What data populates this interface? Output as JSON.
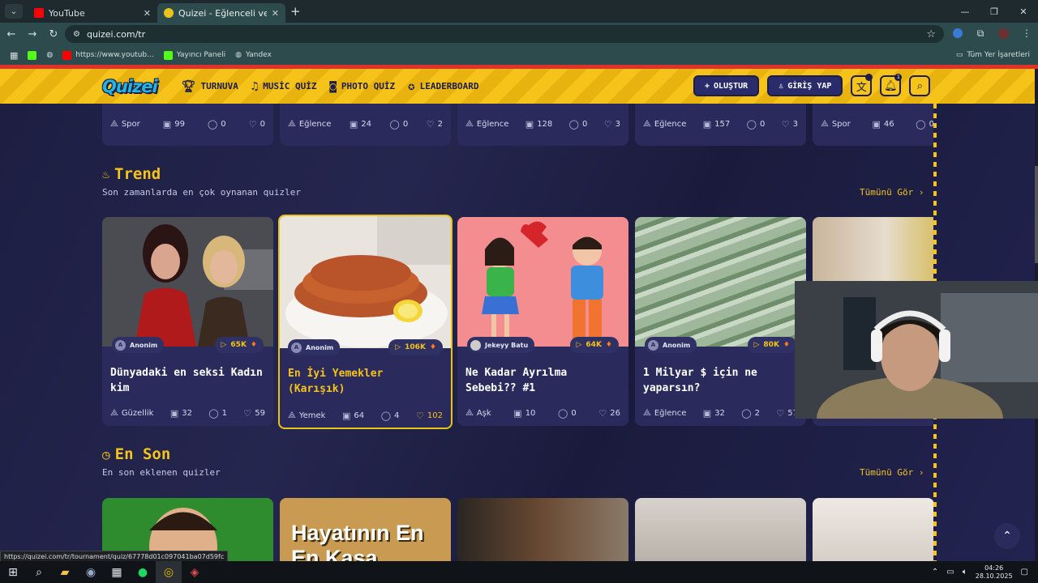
{
  "browser": {
    "tabs": [
      {
        "title": "YouTube",
        "active": false
      },
      {
        "title": "Quizei - Eğlenceli ve etkileşimli",
        "active": true
      }
    ],
    "url": "quizei.com/tr",
    "bookmarks": [
      "https://www.youtub...",
      "Yayıncı Paneli",
      "Yandex"
    ],
    "bookmarks_right": "Tüm Yer İşaretleri",
    "status_url": "https://quizei.com/tr/tournament/quiz/67778d01c097041ba07d59fc"
  },
  "header": {
    "logo": "Quizei",
    "nav": [
      "TURNUVA",
      "MUSİC QUİZ",
      "PHOTO QUİZ",
      "LEADERBOARD"
    ],
    "create": "OLUŞTUR",
    "login": "GİRİŞ YAP",
    "notification_count": "1"
  },
  "top_row": [
    {
      "category": "Spor",
      "questions": "99",
      "comments": "0",
      "likes": "0"
    },
    {
      "category": "Eğlence",
      "questions": "24",
      "comments": "0",
      "likes": "2"
    },
    {
      "category": "Eğlence",
      "questions": "128",
      "comments": "0",
      "likes": "3"
    },
    {
      "category": "Eğlence",
      "questions": "157",
      "comments": "0",
      "likes": "3"
    },
    {
      "category": "Spor",
      "questions": "46",
      "comments": "0",
      "likes": ""
    }
  ],
  "trend": {
    "title": "Trend",
    "subtitle": "Son zamanlarda en çok oynanan quizler",
    "see_all": "Tümünü Gör",
    "cards": [
      {
        "author": "Anonim",
        "plays": "65K",
        "title": "Dünyadaki en seksi Kadın kim",
        "category": "Güzellik",
        "questions": "32",
        "comments": "1",
        "likes": "59"
      },
      {
        "author": "Anonim",
        "plays": "106K",
        "title": "En İyi Yemekler (Karışık)",
        "category": "Yemek",
        "questions": "64",
        "comments": "4",
        "likes": "102"
      },
      {
        "author": "Jekeyy Batu",
        "plays": "64K",
        "title": "Ne Kadar Ayrılma Sebebi?? #1",
        "category": "Aşk",
        "questions": "10",
        "comments": "0",
        "likes": "26"
      },
      {
        "author": "Anonim",
        "plays": "80K",
        "title": "1 Milyar $ için ne yaparsın?",
        "category": "Eğlence",
        "questions": "32",
        "comments": "2",
        "likes": "57"
      }
    ]
  },
  "latest": {
    "title": "En Son",
    "subtitle": "En son eklenen quizler",
    "see_all": "Tümünü Gör",
    "thumb2_text_1": "Hayatının En",
    "thumb2_text_2": "En Kasa"
  },
  "taskbar": {
    "time": "04:26",
    "date": "28.10.2025"
  }
}
